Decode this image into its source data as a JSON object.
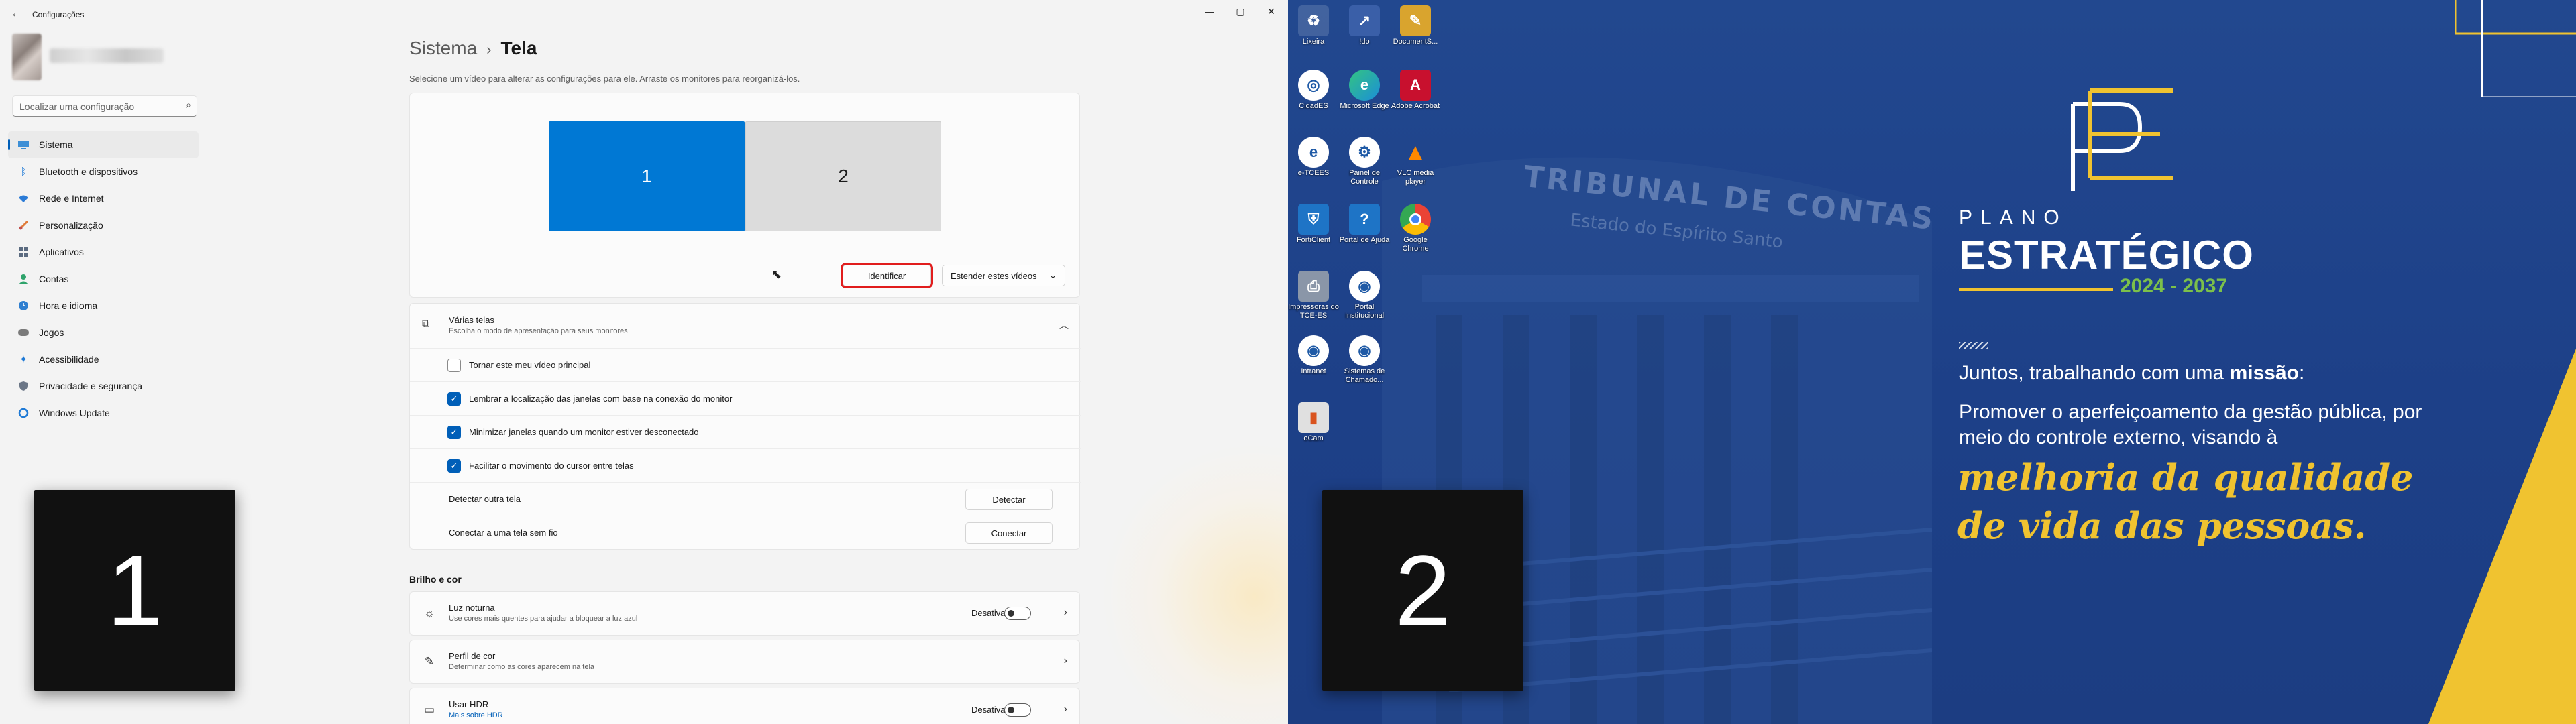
{
  "window": {
    "title": "Configurações",
    "back_icon": "back-arrow-icon",
    "minimize_icon": "minimize-icon",
    "maximize_icon": "maximize-icon",
    "close_icon": "close-icon"
  },
  "search": {
    "placeholder": "Localizar uma configuração",
    "value": ""
  },
  "sidebar": {
    "items": [
      {
        "label": "Sistema",
        "icon": "system-icon",
        "active": true
      },
      {
        "label": "Bluetooth e dispositivos",
        "icon": "bluetooth-icon"
      },
      {
        "label": "Rede e Internet",
        "icon": "network-icon"
      },
      {
        "label": "Personalização",
        "icon": "brush-icon"
      },
      {
        "label": "Aplicativos",
        "icon": "apps-icon"
      },
      {
        "label": "Contas",
        "icon": "accounts-icon"
      },
      {
        "label": "Hora e idioma",
        "icon": "time-language-icon"
      },
      {
        "label": "Jogos",
        "icon": "gaming-icon"
      },
      {
        "label": "Acessibilidade",
        "icon": "accessibility-icon"
      },
      {
        "label": "Privacidade e segurança",
        "icon": "shield-icon"
      },
      {
        "label": "Windows Update",
        "icon": "windows-update-icon"
      }
    ]
  },
  "breadcrumb": {
    "parent": "Sistema",
    "separator": "›",
    "current": "Tela"
  },
  "subtitle": "Selecione um vídeo para alterar as configurações para ele. Arraste os monitores para reorganizá-los.",
  "arrangement": {
    "displays": [
      "1",
      "2"
    ],
    "identify_label": "Identificar",
    "extend_label": "Estender estes vídeos",
    "extend_chevron": "⌄"
  },
  "multiple_displays": {
    "title": "Várias telas",
    "description": "Escolha o modo de apresentação para seus monitores",
    "options": [
      {
        "label": "Tornar este meu vídeo principal",
        "checked": false
      },
      {
        "label": "Lembrar a localização das janelas com base na conexão do monitor",
        "checked": true
      },
      {
        "label": "Minimizar janelas quando um monitor estiver desconectado",
        "checked": true
      },
      {
        "label": "Facilitar o movimento do cursor entre telas",
        "checked": true
      }
    ],
    "detect_label": "Detectar outra tela",
    "detect_button": "Detectar",
    "connect_label": "Conectar a uma tela sem fio",
    "connect_button": "Conectar"
  },
  "brightness": {
    "heading": "Brilho e cor",
    "night_light": {
      "title": "Luz noturna",
      "description": "Use cores mais quentes para ajudar a bloquear a luz azul",
      "state": "Desativado"
    },
    "color_profile": {
      "title": "Perfil de cor",
      "description": "Determinar como as cores aparecem na tela"
    },
    "hdr": {
      "title": "Usar HDR",
      "link": "Mais sobre HDR",
      "state": "Desativado"
    }
  },
  "identify_overlays": [
    "1",
    "2"
  ],
  "desktop_icons": [
    {
      "label": "Lixeira",
      "icon": "recycle-bin-icon"
    },
    {
      "label": "!do",
      "icon": "shortcut-icon"
    },
    {
      "label": "DocumentS...",
      "icon": "document-icon"
    },
    {
      "label": "CidadES",
      "icon": "cidades-icon"
    },
    {
      "label": "Microsoft Edge",
      "icon": "edge-icon"
    },
    {
      "label": "Adobe Acrobat",
      "icon": "acrobat-icon"
    },
    {
      "label": "e-TCEES",
      "icon": "etcees-icon"
    },
    {
      "label": "Painel de Controle",
      "icon": "control-panel-icon"
    },
    {
      "label": "VLC media player",
      "icon": "vlc-icon"
    },
    {
      "label": "FortiClient",
      "icon": "forticlient-icon"
    },
    {
      "label": "Portal de Ajuda",
      "icon": "help-portal-icon"
    },
    {
      "label": "Google Chrome",
      "icon": "chrome-icon"
    },
    {
      "label": "Impressoras do TCE-ES",
      "icon": "printer-icon"
    },
    {
      "label": "Portal Institucional",
      "icon": "portal-icon"
    },
    {
      "label": "Intranet",
      "icon": "intranet-icon"
    },
    {
      "label": "Sistemas de Chamado...",
      "icon": "ticket-icon"
    },
    {
      "label": "oCam",
      "icon": "ocam-icon"
    }
  ],
  "wallpaper": {
    "building_sign": "TRIBUNAL DE CONTAS",
    "building_sub": "Estado do Espírito Santo",
    "plano": "PLANO",
    "estrategico": "ESTRATÉGICO",
    "years": "2024 - 2037",
    "juntos_prefix": "Juntos, trabalhando com uma ",
    "juntos_bold": "missão",
    "juntos_suffix": ":",
    "promover": "Promover o aperfeiçoamento da gestão pública, por meio do controle externo, visando à",
    "melhoria": "melhoria da qualidade de vida das pessoas.",
    "accent_yellow": "#f0c330",
    "accent_green": "#7cc04a",
    "background_blue": "#1e3f80"
  }
}
